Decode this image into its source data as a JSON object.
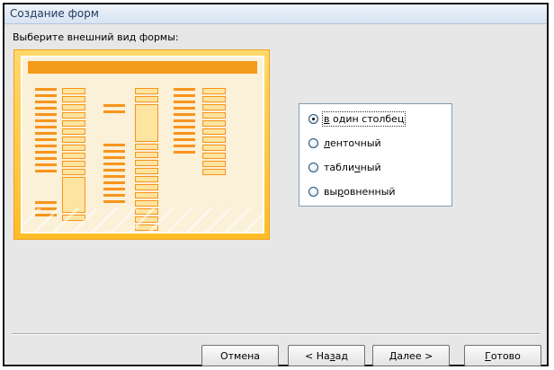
{
  "window": {
    "title": "Создание форм"
  },
  "prompt": "Выберите внешний вид формы:",
  "options": [
    {
      "before": "",
      "key": "в",
      "after": " один столбец",
      "checked": true,
      "focused": true
    },
    {
      "before": "",
      "key": "л",
      "after": "енточный",
      "checked": false,
      "focused": false
    },
    {
      "before": "табли",
      "key": "ч",
      "after": "ный",
      "checked": false,
      "focused": false
    },
    {
      "before": "вы",
      "key": "р",
      "after": "овненный",
      "checked": false,
      "focused": false
    }
  ],
  "buttons": {
    "cancel": {
      "before": "Отмена",
      "key": "",
      "after": ""
    },
    "back": {
      "before": "< На",
      "key": "з",
      "after": "ад"
    },
    "next": {
      "before": "",
      "key": "Д",
      "after": "алее >"
    },
    "finish": {
      "before": "",
      "key": "Г",
      "after": "отово"
    }
  },
  "colors": {
    "preview_accent": "#f7941d",
    "preview_frame": "#ffc83d"
  }
}
